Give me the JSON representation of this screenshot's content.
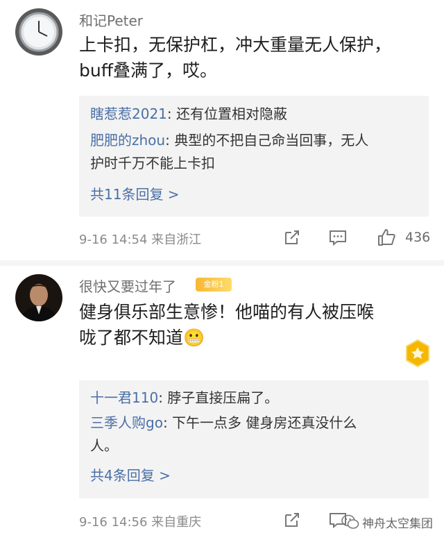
{
  "comments": [
    {
      "username": "和记Peter",
      "text_lines": [
        "上卡扣，无保护杠，冲大重量无人保护，",
        "buff叠满了，哎。"
      ],
      "replies": [
        {
          "name": "瞎惹惹2021",
          "text": ": 还有位置相对隐蔽"
        },
        {
          "name": "肥肥的zhou",
          "text": ": 典型的不把自己命当回事，无人",
          "text2": "护时千万不能上卡扣"
        }
      ],
      "more_replies": "共11条回复 >",
      "timestamp": "9-16 14:54 来自浙江",
      "likes": "436"
    },
    {
      "username": "很快又要过年了",
      "badge": "金粉1",
      "text_lines": [
        "健身俱乐部生意惨！他喵的有人被压喉",
        "咙了都不知道😬"
      ],
      "replies": [
        {
          "name": "十一君110",
          "text": ": 脖子直接压扁了。"
        },
        {
          "name": "三季人购go",
          "text": ": 下午一点多 健身房还真没什么",
          "text2": "人。"
        }
      ],
      "more_replies": "共4条回复 >",
      "timestamp": "9-16 14:56 来自重庆"
    }
  ],
  "watermark": "神舟太空集团",
  "icons": [
    "share-icon",
    "comment-icon",
    "like-icon",
    "wechat-icon",
    "medal-icon"
  ],
  "colors": {
    "link": "#4a6fa6",
    "reply_bg": "#f3f3f3",
    "badge": "#f7b733"
  }
}
